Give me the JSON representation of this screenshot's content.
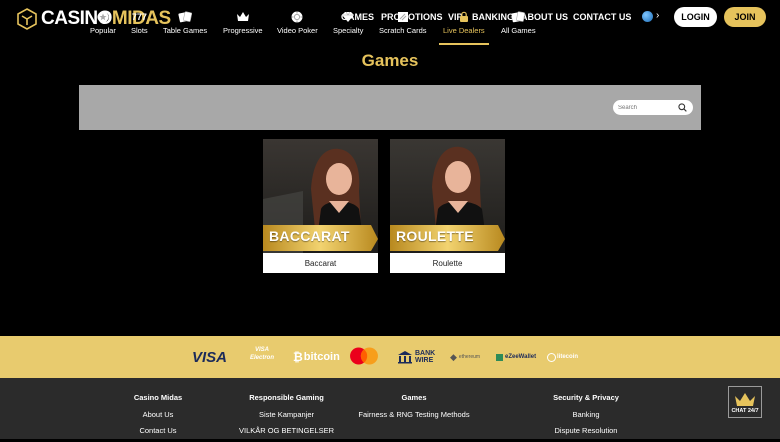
{
  "header": {
    "logo_casino": "CASINO",
    "logo_midas": "MIDAS",
    "nav": [
      {
        "label": "GAMES"
      },
      {
        "label": "PROMOTIONS"
      },
      {
        "label": "VIP"
      },
      {
        "label": "BANKING"
      },
      {
        "label": "ABOUT US"
      },
      {
        "label": "CONTACT US"
      }
    ],
    "language_icon": "globe-icon",
    "login_label": "LOGIN",
    "join_label": "JOIN"
  },
  "page_title": "Games",
  "categories": [
    {
      "label": "Popular",
      "icon": "star-icon"
    },
    {
      "label": "Slots",
      "icon": "777-icon"
    },
    {
      "label": "Table Games",
      "icon": "cards-icon"
    },
    {
      "label": "Progressive",
      "icon": "crown-icon"
    },
    {
      "label": "Video Poker",
      "icon": "chip-icon"
    },
    {
      "label": "Specialty",
      "icon": "diamond-icon"
    },
    {
      "label": "Scratch Cards",
      "icon": "scratch-icon"
    },
    {
      "label": "Live Dealers",
      "icon": "lock-icon",
      "active": true
    },
    {
      "label": "All Games",
      "icon": "cards-icon"
    }
  ],
  "search": {
    "placeholder": "Search"
  },
  "games": [
    {
      "banner": "BACCARAT",
      "label": "Baccarat"
    },
    {
      "banner": "ROULETTE",
      "label": "Roulette"
    }
  ],
  "payments": {
    "visa": "VISA",
    "visa_electron_1": "VISA",
    "visa_electron_2": "Electron",
    "bitcoin": "bitcoin",
    "bankwire_1": "BANK",
    "bankwire_2": "WIRE",
    "ethereum": "ethereum",
    "ezeewallet": "eZeeWallet",
    "litecoin": "litecoin"
  },
  "footer": {
    "col1": {
      "heading": "Casino Midas",
      "links": [
        "About Us",
        "Contact Us"
      ]
    },
    "col2": {
      "heading": "Responsible Gaming",
      "links": [
        "Siste Kampanjer",
        "VILKÅR OG BETINGELSER"
      ]
    },
    "col3": {
      "heading": "Games",
      "links": [
        "Fairness & RNG Testing Methods"
      ]
    },
    "col4": {
      "heading": "Security & Privacy",
      "links": [
        "Banking",
        "Dispute Resolution"
      ]
    }
  },
  "chat_label": "CHAT 24/7",
  "colors": {
    "gold": "#e6c35c",
    "strip": "#e8cb6e",
    "catbar": "#a8a8a8",
    "footer": "#2b2b2b"
  }
}
